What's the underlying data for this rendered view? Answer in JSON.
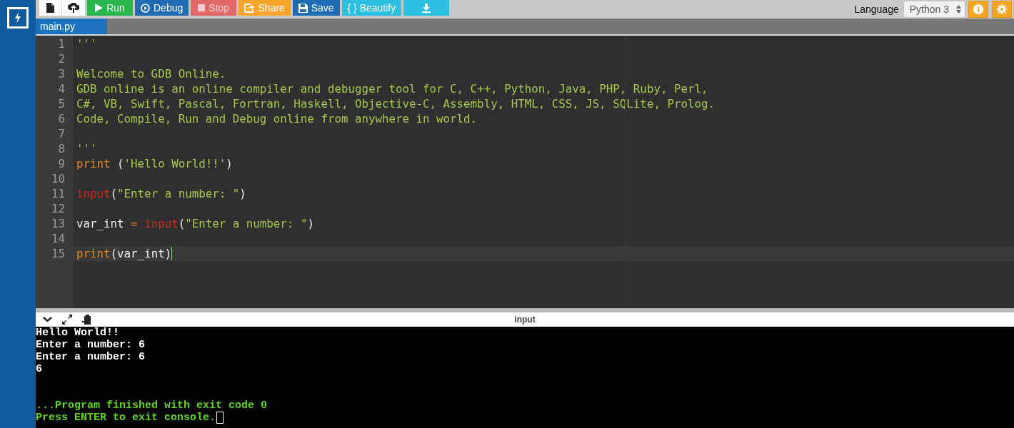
{
  "toolbar": {
    "buttons": [
      {
        "kind": "new-file"
      },
      {
        "kind": "upload"
      },
      {
        "kind": "run",
        "label": "Run"
      },
      {
        "kind": "debug",
        "label": "Debug"
      },
      {
        "kind": "stop",
        "label": "Stop",
        "disabled": true
      },
      {
        "kind": "share",
        "label": "Share"
      },
      {
        "kind": "save",
        "label": "Save"
      },
      {
        "kind": "beautify",
        "label": "{ } Beautify"
      },
      {
        "kind": "download"
      }
    ],
    "language_label": "Language",
    "language": "Python 3",
    "right_buttons": [
      {
        "kind": "info"
      },
      {
        "kind": "settings"
      }
    ]
  },
  "tabs": [
    {
      "label": "main.py",
      "selected": true
    }
  ],
  "editor": {
    "lines": [
      {
        "number": "1",
        "tokens": [
          {
            "kind": "string",
            "text": "'''"
          }
        ]
      },
      {
        "number": "2"
      },
      {
        "number": "3",
        "tokens": [
          {
            "kind": "string",
            "text": "Welcome to GDB Online."
          }
        ]
      },
      {
        "number": "4",
        "tokens": [
          {
            "kind": "string",
            "text": "GDB online is an online compiler and debugger tool for C, C++, Python, Java, PHP, Ruby, Perl,"
          }
        ]
      },
      {
        "number": "5",
        "tokens": [
          {
            "kind": "string",
            "text": "C#, VB, Swift, Pascal, Fortran, Haskell, Objective-C, Assembly, HTML, CSS, JS, SQLite, Prolog."
          }
        ]
      },
      {
        "number": "6",
        "tokens": [
          {
            "kind": "string",
            "text": "Code, Compile, Run and Debug online from anywhere in world."
          }
        ]
      },
      {
        "number": "7"
      },
      {
        "number": "8",
        "tokens": [
          {
            "kind": "string",
            "text": "'''"
          }
        ]
      },
      {
        "number": "9",
        "tokens": [
          {
            "kind": "keyword",
            "text": "print"
          },
          {
            "kind": "plain",
            "text": " ("
          },
          {
            "kind": "string",
            "text": "'Hello World!!'"
          },
          {
            "kind": "plain",
            "text": ")"
          }
        ]
      },
      {
        "number": "10"
      },
      {
        "number": "11",
        "tokens": [
          {
            "kind": "builtin",
            "text": "input"
          },
          {
            "kind": "plain",
            "text": "("
          },
          {
            "kind": "string",
            "text": "\"Enter a number: \""
          },
          {
            "kind": "plain",
            "text": ")"
          }
        ]
      },
      {
        "number": "12"
      },
      {
        "number": "13",
        "tokens": [
          {
            "kind": "plain",
            "text": "var_int "
          },
          {
            "kind": "keyword",
            "text": "= "
          },
          {
            "kind": "builtin",
            "text": "input"
          },
          {
            "kind": "plain",
            "text": "("
          },
          {
            "kind": "string",
            "text": "\"Enter a number: \""
          },
          {
            "kind": "plain",
            "text": ")"
          }
        ]
      },
      {
        "number": "14"
      },
      {
        "number": "15",
        "active": true,
        "tokens": [
          {
            "kind": "keyword",
            "text": "print"
          },
          {
            "kind": "plain",
            "text": "(var_int)"
          }
        ]
      }
    ]
  },
  "console": {
    "title": "input",
    "lines": [
      {
        "kind": "output",
        "text": "Hello World!!"
      },
      {
        "kind": "output",
        "text": "Enter a number: 6"
      },
      {
        "kind": "output",
        "text": "Enter a number: 6"
      },
      {
        "kind": "output",
        "text": "6"
      },
      {
        "kind": "blank"
      },
      {
        "kind": "blank"
      },
      {
        "kind": "status",
        "text": "...Program finished with exit code 0"
      },
      {
        "kind": "status",
        "text": "Press ENTER to exit console.",
        "cursor": true
      }
    ]
  }
}
